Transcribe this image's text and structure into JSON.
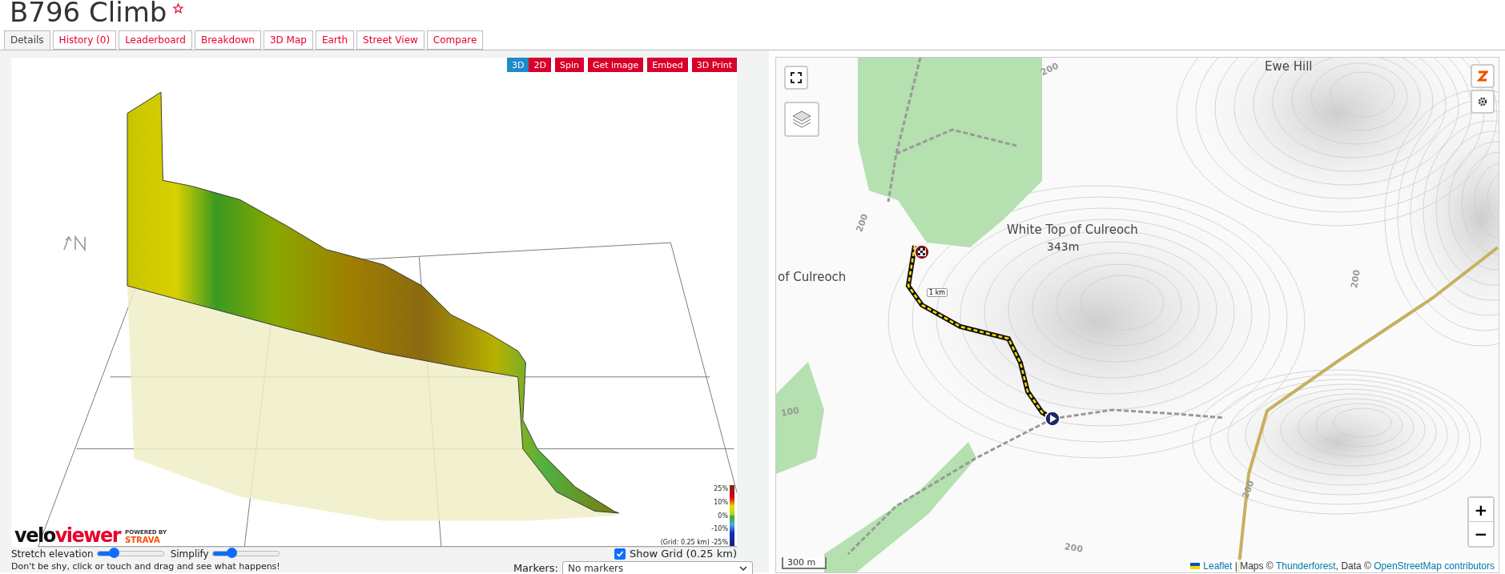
{
  "title": "B796 Climb",
  "starred": false,
  "tabs": [
    {
      "label": "Details",
      "selected": true
    },
    {
      "label": "History (0)",
      "selected": false
    },
    {
      "label": "Leaderboard",
      "selected": false
    },
    {
      "label": "Breakdown",
      "selected": false
    },
    {
      "label": "3D Map",
      "selected": false
    },
    {
      "label": "Earth",
      "selected": false
    },
    {
      "label": "Street View",
      "selected": false
    },
    {
      "label": "Compare",
      "selected": false
    }
  ],
  "view_modes": [
    {
      "label": "3D",
      "selected": true
    },
    {
      "label": "2D",
      "selected": false
    }
  ],
  "actions": [
    "Spin",
    "Get image",
    "Embed",
    "3D Print"
  ],
  "legend": [
    "25%",
    "10%",
    "0%",
    "-10%",
    "(Grid: 0.25 km) -25%"
  ],
  "logo": {
    "wordmark_start": "velo",
    "wordmark_end": "viewer",
    "powered_by": "POWERED BY",
    "partner": "STRAVA"
  },
  "sliders": [
    {
      "label": "Stretch elevation",
      "level": 0.25
    },
    {
      "label": "Simplify",
      "level": 0.28
    }
  ],
  "show_grid": {
    "label": "Show Grid (0.25 km)",
    "checked": true
  },
  "hint": "Don't be shy, click or touch and drag and see what happens!",
  "markers": {
    "label": "Markers:",
    "value": "No markers"
  },
  "map": {
    "labels": [
      {
        "kind": "place",
        "text": "Ewe Hill"
      },
      {
        "kind": "place",
        "text": "White Top of Culreoch"
      },
      {
        "kind": "height",
        "text": "343m"
      },
      {
        "kind": "place",
        "text": "of Culreoch"
      },
      {
        "kind": "contour",
        "text": "200"
      },
      {
        "kind": "contour",
        "text": "200"
      },
      {
        "kind": "contour",
        "text": "200"
      },
      {
        "kind": "contour",
        "text": "200"
      },
      {
        "kind": "contour",
        "text": "200"
      },
      {
        "kind": "contour",
        "text": "100"
      }
    ],
    "route_marker": "1 km",
    "scale": "300 m",
    "zoom_in": "+",
    "zoom_out": "−",
    "attribution": [
      {
        "text": "Leaflet",
        "link": true
      },
      {
        "text": " | Maps © ",
        "link": false
      },
      {
        "text": "Thunderforest",
        "link": true
      },
      {
        "text": ", Data © ",
        "link": false
      },
      {
        "text": "OpenStreetMap contributors",
        "link": true
      }
    ]
  }
}
